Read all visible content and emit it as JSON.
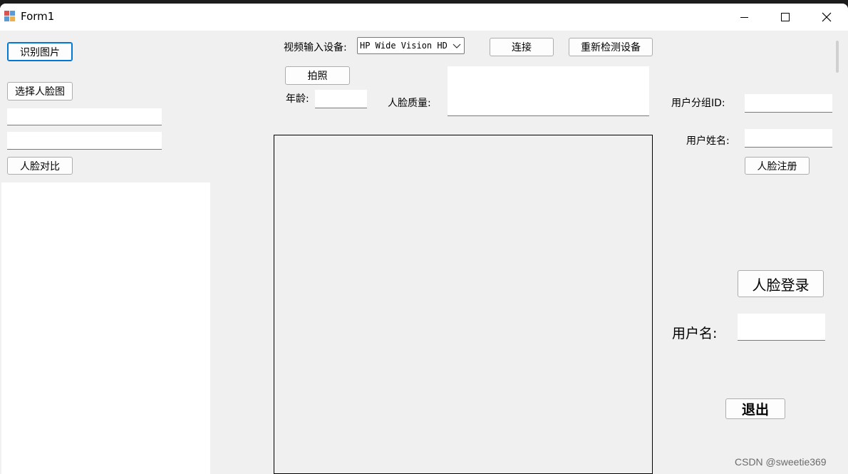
{
  "window": {
    "title": "Form1",
    "icons": {
      "app": "form-app-icon",
      "minimize": "minimize-icon",
      "maximize": "maximize-icon",
      "close": "close-icon"
    }
  },
  "left": {
    "recognize_btn": "识别图片",
    "select_face_btn": "选择人脸图",
    "compare_btn": "人脸对比",
    "textbox1_value": "",
    "textbox2_value": ""
  },
  "camera": {
    "device_label": "视频输入设备:",
    "device_selected": "HP Wide Vision HD",
    "connect_btn": "连接",
    "redetect_btn": "重新检测设备",
    "photo_btn": "拍照",
    "age_label": "年龄:",
    "age_value": "",
    "quality_label": "人脸质量:",
    "quality_value": ""
  },
  "register": {
    "group_id_label": "用户分组ID:",
    "group_id_value": "",
    "user_name_label": "用户姓名:",
    "user_name_value": "",
    "register_btn": "人脸注册"
  },
  "login": {
    "login_btn": "人脸登录",
    "username_label": "用户名:",
    "username_value": "",
    "exit_btn": "退出"
  },
  "watermark": "CSDN @sweetie369"
}
